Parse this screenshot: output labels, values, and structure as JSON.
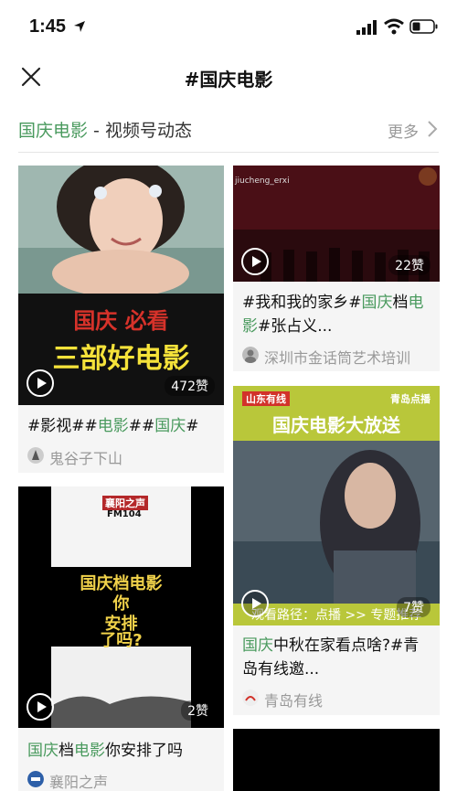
{
  "status_bar": {
    "time": "1:45"
  },
  "nav": {
    "title": "#国庆电影"
  },
  "section": {
    "title_highlight": "国庆电影",
    "title_rest": " - 视频号动态",
    "more_label": "更多"
  },
  "cards": [
    {
      "thumb_line1": "国庆 必看",
      "thumb_line2": "三部好电影",
      "likes": "472赞",
      "caption": [
        "#影视##",
        "电影",
        "##",
        "国庆",
        "#"
      ],
      "author": "鬼谷子下山"
    },
    {
      "thumb_watermark": "jiucheng_erxi",
      "likes": "22赞",
      "caption": [
        "#我和我的家乡#",
        "国庆",
        "档",
        "电影",
        "#张占义..."
      ],
      "author": "深圳市金话筒艺术培训"
    },
    {
      "thumb_brand_left": "山东有线",
      "thumb_brand_right": "青岛点播",
      "thumb_banner": "国庆电影大放送",
      "thumb_bottom": "观看路径：点播 >> 专题推荐",
      "likes": "7赞",
      "caption": [
        "国庆",
        "中秋在家看点啥?#青岛有线邀..."
      ],
      "author": "青岛有线"
    },
    {
      "thumb_badge": "襄阳之声",
      "thumb_badge2": "FM104",
      "thumb_text": [
        "国庆档电影",
        "你",
        "安排",
        "了吗?"
      ],
      "likes": "2赞",
      "caption": [
        "国庆",
        "档",
        "电影",
        "你安排了吗"
      ],
      "author": "襄阳之声"
    }
  ],
  "colors": {
    "accent": "#4a9a5e",
    "muted": "#999999",
    "card_bg": "#f5f5f5"
  }
}
